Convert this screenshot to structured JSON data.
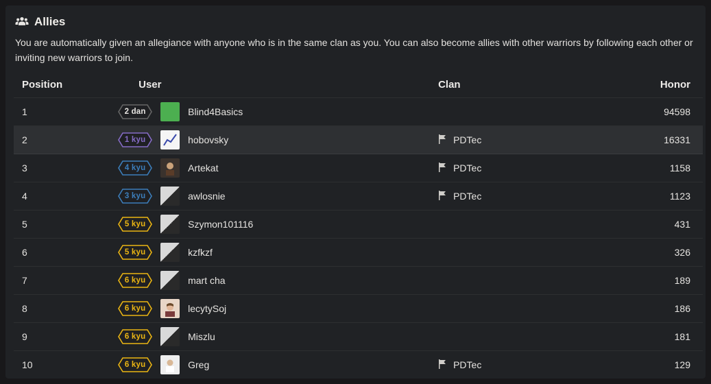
{
  "header": {
    "title": "Allies",
    "description": "You are automatically given an allegiance with anyone who is in the same clan as you. You can also become allies with other warriors by following each other or inviting new warriors to join."
  },
  "columns": {
    "position": "Position",
    "user": "User",
    "clan": "Clan",
    "honor": "Honor"
  },
  "rank_colors": {
    "dan": {
      "stroke": "#666666",
      "fill": "#1f2023",
      "text": "#e6e4e1"
    },
    "purple": {
      "stroke": "#866cc7",
      "fill": "#1f2023",
      "text": "#866cc7"
    },
    "blue": {
      "stroke": "#3c7ebb",
      "fill": "#1f2023",
      "text": "#3c7ebb"
    },
    "yellow": {
      "stroke": "#ecb613",
      "fill": "#1f2023",
      "text": "#ecb613"
    }
  },
  "rows": [
    {
      "position": 1,
      "rank_label": "2 dan",
      "rank_style": "dan",
      "avatar": "green",
      "username": "Blind4Basics",
      "clan": "",
      "honor": 94598,
      "highlight": false
    },
    {
      "position": 2,
      "rank_label": "1 kyu",
      "rank_style": "purple",
      "avatar": "chart",
      "username": "hobovsky",
      "clan": "PDTec",
      "honor": 16331,
      "highlight": true
    },
    {
      "position": 3,
      "rank_label": "4 kyu",
      "rank_style": "blue",
      "avatar": "face",
      "username": "Artekat",
      "clan": "PDTec",
      "honor": 1158,
      "highlight": false
    },
    {
      "position": 4,
      "rank_label": "3 kyu",
      "rank_style": "blue",
      "avatar": "bw",
      "username": "awlosnie",
      "clan": "PDTec",
      "honor": 1123,
      "highlight": false
    },
    {
      "position": 5,
      "rank_label": "5 kyu",
      "rank_style": "yellow",
      "avatar": "bw",
      "username": "Szymon101116",
      "clan": "",
      "honor": 431,
      "highlight": false
    },
    {
      "position": 6,
      "rank_label": "5 kyu",
      "rank_style": "yellow",
      "avatar": "bw",
      "username": "kzfkzf",
      "clan": "",
      "honor": 326,
      "highlight": false
    },
    {
      "position": 7,
      "rank_label": "6 kyu",
      "rank_style": "yellow",
      "avatar": "bw",
      "username": "mart cha",
      "clan": "",
      "honor": 189,
      "highlight": false
    },
    {
      "position": 8,
      "rank_label": "6 kyu",
      "rank_style": "yellow",
      "avatar": "photo",
      "username": "lecytySoj",
      "clan": "",
      "honor": 186,
      "highlight": false
    },
    {
      "position": 9,
      "rank_label": "6 kyu",
      "rank_style": "yellow",
      "avatar": "bw",
      "username": "Miszlu",
      "clan": "",
      "honor": 181,
      "highlight": false
    },
    {
      "position": 10,
      "rank_label": "6 kyu",
      "rank_style": "yellow",
      "avatar": "white",
      "username": "Greg",
      "clan": "PDTec",
      "honor": 129,
      "highlight": false
    }
  ]
}
